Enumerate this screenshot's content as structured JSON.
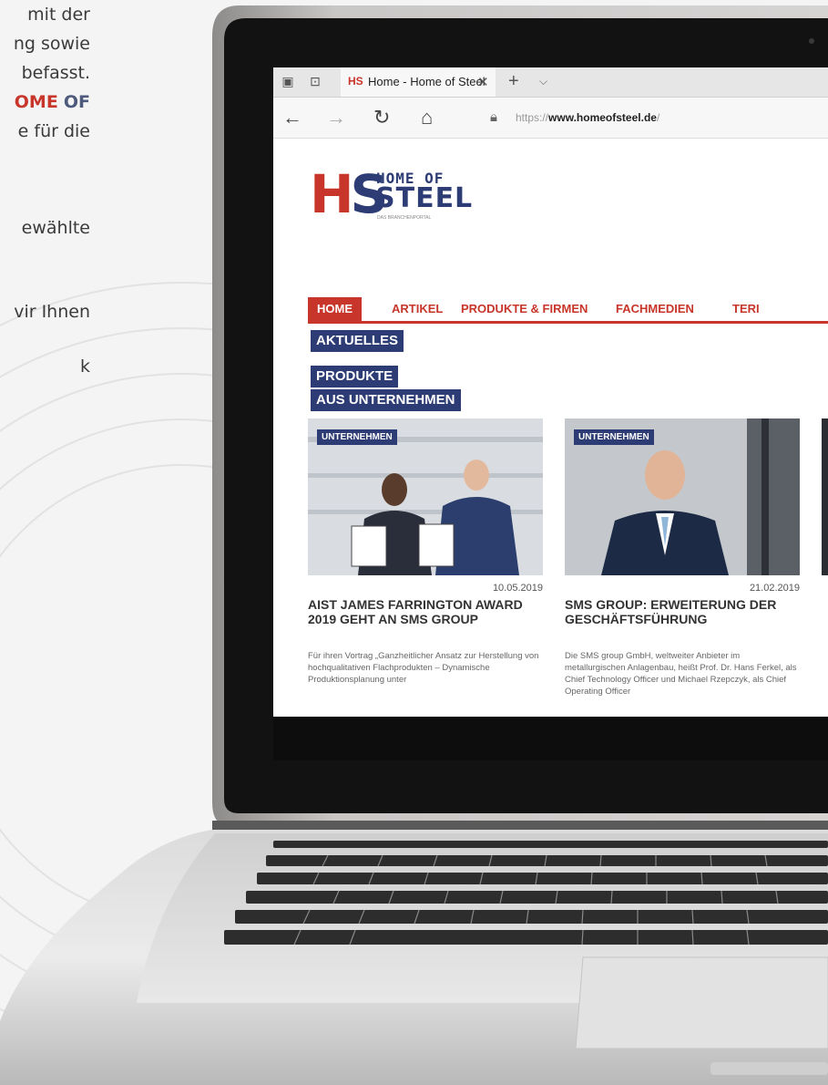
{
  "left_text": {
    "line1": "mit der",
    "line2": "ng sowie",
    "line3": "befasst.",
    "line4_red": "OME",
    "line4_blue": "OF",
    "line5": "e für die",
    "line6": "ewählte",
    "line7": "vir Ihnen",
    "line8": "k"
  },
  "browser": {
    "tab_favicon": "HS",
    "tab_title": "Home - Home of Steel",
    "tab_close": "✕",
    "new_tab": "+",
    "tab_menu": "⌵",
    "back": "←",
    "forward": "→",
    "refresh": "↻",
    "home": "⌂",
    "url_prefix": "https://",
    "url_domain": "www.homeofsteel.de",
    "url_suffix": "/"
  },
  "site": {
    "logo": {
      "h": "H",
      "s": "S",
      "line1": "HOME OF",
      "line2": "STEEL",
      "tagline": "DAS BRANCHENPORTAL"
    },
    "menu": [
      "HOME",
      "ARTIKEL",
      "PRODUKTE & FIRMEN",
      "FACHMEDIEN",
      "TERI"
    ],
    "tags": [
      "AKTUELLES",
      "PRODUKTE",
      "AUS UNTERNEHMEN"
    ],
    "cards": [
      {
        "badge": "UNTERNEHMEN",
        "date": "10.05.2019",
        "title": "AIST JAMES FARRINGTON AWARD 2019 GEHT AN SMS GROUP",
        "excerpt": "Für ihren Vortrag „Ganzheitlicher Ansatz zur Herstellung von hochqualitativen Flachprodukten – Dynamische Produktionsplanung unter"
      },
      {
        "badge": "UNTERNEHMEN",
        "date": "21.02.2019",
        "title": "SMS GROUP: ERWEITERUNG DER GESCHÄFTSFÜHRUNG",
        "excerpt": "Die SMS group GmbH, weltweiter Anbieter im metallurgischen Anlagenbau, heißt Prof. Dr. Hans Ferkel, als Chief Technology Officer und Michael Rzepczyk, als Chief Operating Officer"
      }
    ]
  }
}
